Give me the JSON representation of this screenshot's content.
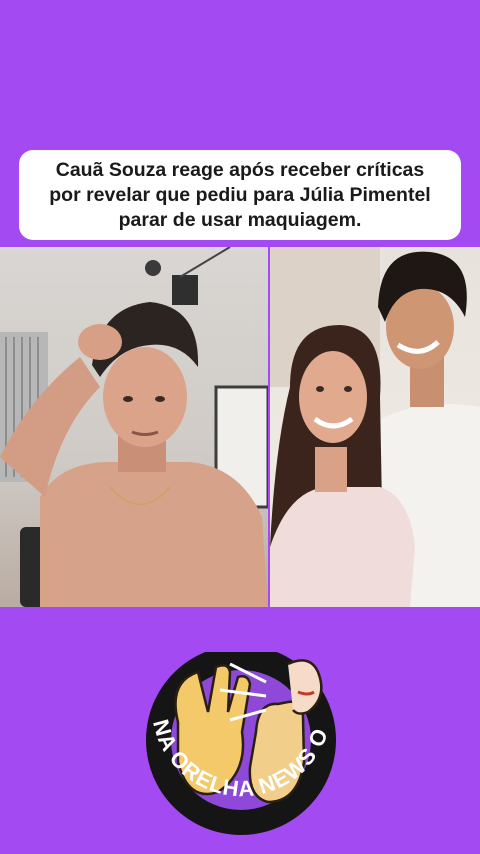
{
  "headline": {
    "lines": [
      "Cauã Souza reage após receber críticas",
      "por revelar que pediu para Júlia Pimentel",
      "parar de usar maquiagem."
    ]
  },
  "colors": {
    "background": "#a44af2",
    "headline_box": "#ffffff",
    "headline_text": "#1a1a1a",
    "logo_ring": "#151515",
    "logo_inner": "#8e49d9",
    "logo_text": "#ffffff"
  },
  "logo": {
    "text": "NA ORELHA NEWS OFICIAL",
    "icons": [
      "hand-icon",
      "ear-whisper-hand-icon",
      "mouth-icon"
    ]
  }
}
